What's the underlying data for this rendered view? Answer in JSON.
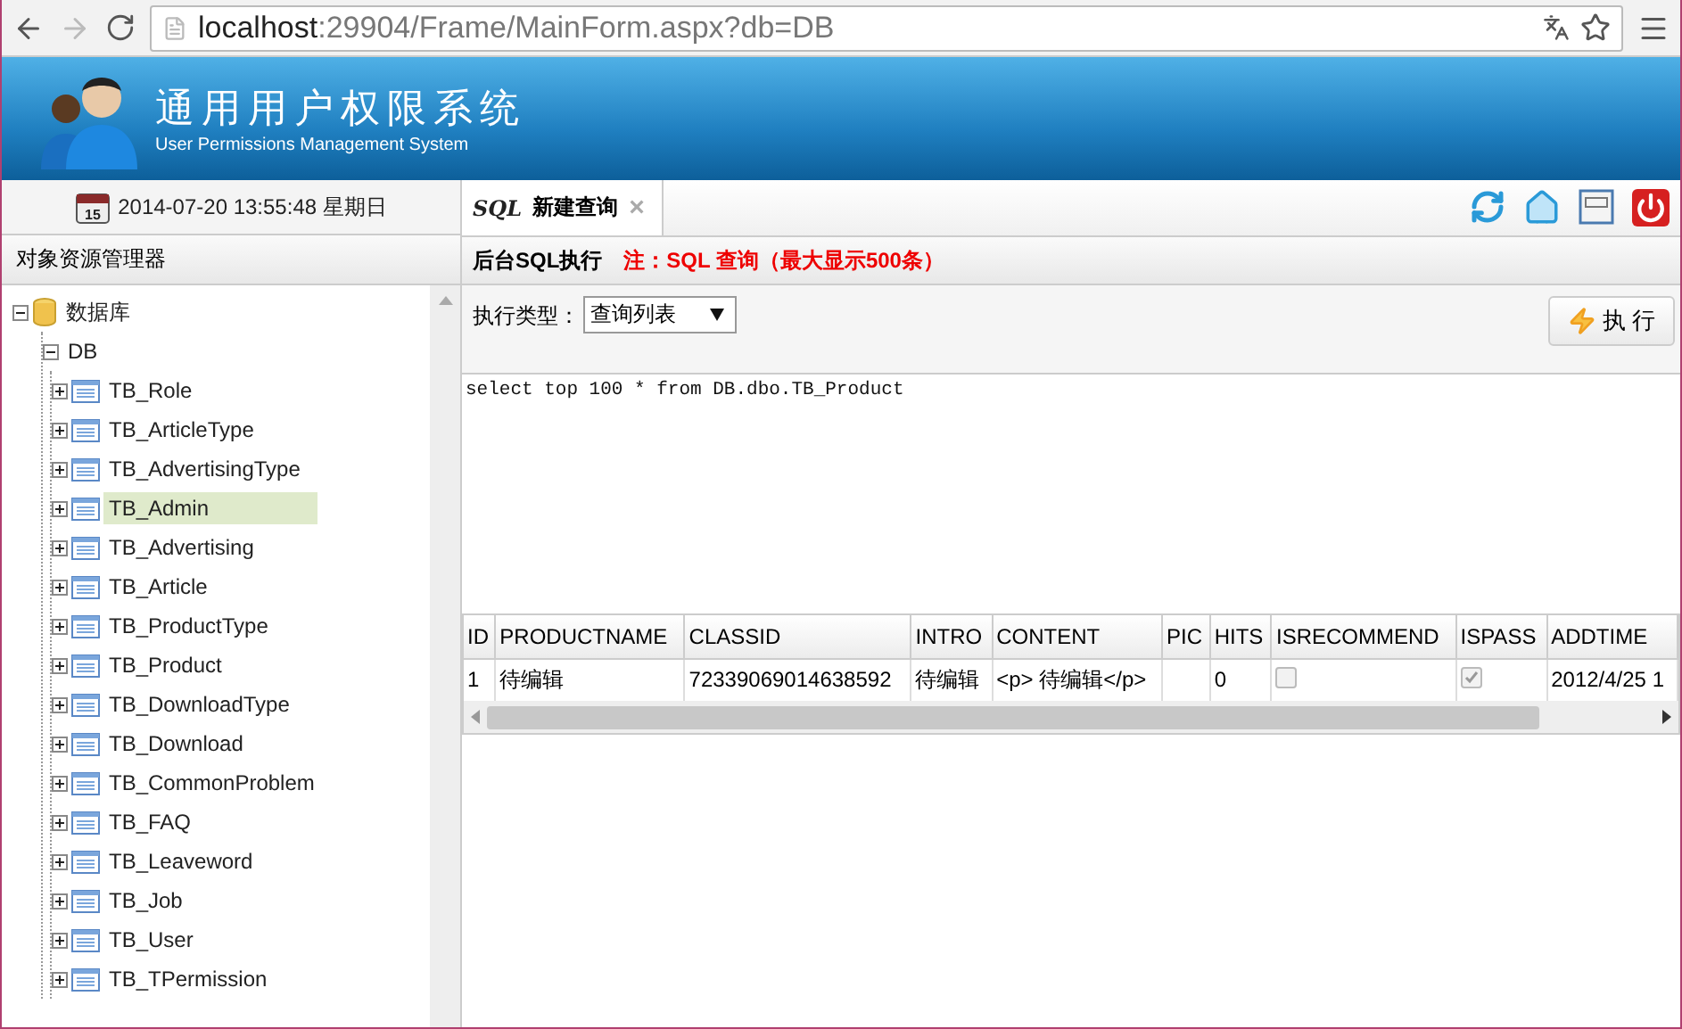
{
  "browser": {
    "url_host": "localhost",
    "url_path": ":29904/Frame/MainForm.aspx?db=DB"
  },
  "header": {
    "title": "通用用户权限系统",
    "subtitle": "User Permissions Management System"
  },
  "sidebar": {
    "datetime": "2014-07-20 13:55:48 星期日",
    "calendar_day": "15",
    "panel_title": "对象资源管理器",
    "tree": [
      {
        "label": "数据库",
        "kind": "database",
        "expanded": true,
        "selected": false,
        "children": [
          {
            "label": "DB",
            "kind": "group",
            "expanded": true,
            "selected": false,
            "children": [
              {
                "label": "TB_Role",
                "kind": "table",
                "expanded": false,
                "selected": false
              },
              {
                "label": "TB_ArticleType",
                "kind": "table",
                "expanded": false,
                "selected": false
              },
              {
                "label": "TB_AdvertisingType",
                "kind": "table",
                "expanded": false,
                "selected": false
              },
              {
                "label": "TB_Admin",
                "kind": "table",
                "expanded": false,
                "selected": true
              },
              {
                "label": "TB_Advertising",
                "kind": "table",
                "expanded": false,
                "selected": false
              },
              {
                "label": "TB_Article",
                "kind": "table",
                "expanded": false,
                "selected": false
              },
              {
                "label": "TB_ProductType",
                "kind": "table",
                "expanded": false,
                "selected": false
              },
              {
                "label": "TB_Product",
                "kind": "table",
                "expanded": false,
                "selected": false
              },
              {
                "label": "TB_DownloadType",
                "kind": "table",
                "expanded": false,
                "selected": false
              },
              {
                "label": "TB_Download",
                "kind": "table",
                "expanded": false,
                "selected": false
              },
              {
                "label": "TB_CommonProblem",
                "kind": "table",
                "expanded": false,
                "selected": false
              },
              {
                "label": "TB_FAQ",
                "kind": "table",
                "expanded": false,
                "selected": false
              },
              {
                "label": "TB_Leaveword",
                "kind": "table",
                "expanded": false,
                "selected": false
              },
              {
                "label": "TB_Job",
                "kind": "table",
                "expanded": false,
                "selected": false
              },
              {
                "label": "TB_User",
                "kind": "table",
                "expanded": false,
                "selected": false
              },
              {
                "label": "TB_TPermission",
                "kind": "table",
                "expanded": false,
                "selected": false
              }
            ]
          }
        ]
      }
    ]
  },
  "tabs": [
    {
      "icon_label": "SQL",
      "label": "新建查询",
      "close": "×",
      "selected": true
    }
  ],
  "panel": {
    "title": "后台SQL执行",
    "note": "注：SQL 查询（最大显示500条）",
    "type_label": "执行类型：",
    "type_value": "查询列表",
    "execute_button": "执 行",
    "query": "select top 100 * from DB.dbo.TB_Product"
  },
  "table": {
    "columns": [
      "ID",
      "PRODUCTNAME",
      "CLASSID",
      "INTRO",
      "CONTENT",
      "PIC",
      "HITS",
      "ISRECOMMEND",
      "ISPASS",
      "ADDTIME"
    ],
    "rows": [
      [
        {
          "kind": "text",
          "text": "1"
        },
        {
          "kind": "text",
          "text": "待编辑"
        },
        {
          "kind": "text",
          "text": "72339069014638592"
        },
        {
          "kind": "text",
          "text": "待编辑"
        },
        {
          "kind": "text",
          "text": "<p> 待编辑</p>"
        },
        {
          "kind": "text",
          "text": ""
        },
        {
          "kind": "text",
          "text": "0"
        },
        {
          "kind": "checkbox",
          "checked": false
        },
        {
          "kind": "checkbox",
          "checked": true
        },
        {
          "kind": "text",
          "text": "2012/4/25 1"
        }
      ]
    ]
  }
}
